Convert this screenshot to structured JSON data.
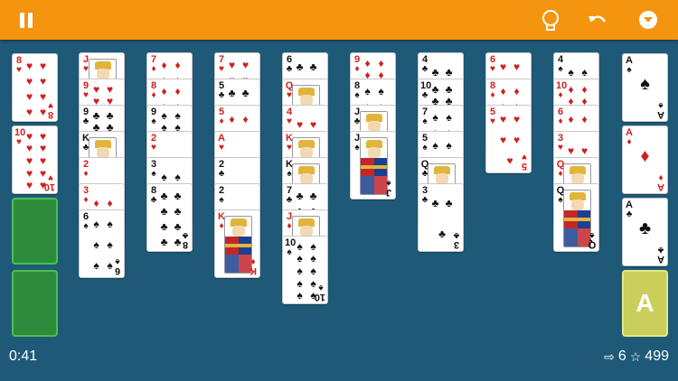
{
  "colors": {
    "topbar": "#f5940f",
    "table": "#1e5a78",
    "free_cell": "#2d8c3c",
    "foundation_slot": "#c9cf5a",
    "red_suit": "#d11f1f"
  },
  "toolbar": {
    "pause_icon": "pause-icon",
    "hint_icon": "lightbulb-icon",
    "undo_icon": "undo-icon",
    "menu_icon": "chevron-down-circle-icon"
  },
  "free_cells": [
    {
      "rank": "8",
      "suit": "♥",
      "color": "red"
    },
    {
      "rank": "10",
      "suit": "♥",
      "color": "red"
    },
    {
      "empty": true
    },
    {
      "empty": true
    }
  ],
  "tableau": [
    [
      {
        "rank": "J",
        "suit": "♥",
        "color": "red"
      },
      {
        "rank": "9",
        "suit": "♥",
        "color": "red"
      },
      {
        "rank": "9",
        "suit": "♣",
        "color": "black"
      },
      {
        "rank": "K",
        "suit": "♣",
        "color": "black"
      },
      {
        "rank": "2",
        "suit": "♦",
        "color": "red"
      },
      {
        "rank": "3",
        "suit": "♦",
        "color": "red"
      },
      {
        "rank": "6",
        "suit": "♠",
        "color": "black"
      }
    ],
    [
      {
        "rank": "7",
        "suit": "♦",
        "color": "red"
      },
      {
        "rank": "8",
        "suit": "♦",
        "color": "red"
      },
      {
        "rank": "9",
        "suit": "♠",
        "color": "black"
      },
      {
        "rank": "2",
        "suit": "♥",
        "color": "red"
      },
      {
        "rank": "3",
        "suit": "♠",
        "color": "black"
      },
      {
        "rank": "8",
        "suit": "♣",
        "color": "black"
      }
    ],
    [
      {
        "rank": "7",
        "suit": "♥",
        "color": "red"
      },
      {
        "rank": "5",
        "suit": "♣",
        "color": "black"
      },
      {
        "rank": "5",
        "suit": "♦",
        "color": "red"
      },
      {
        "rank": "A",
        "suit": "♥",
        "color": "red"
      },
      {
        "rank": "2",
        "suit": "♣",
        "color": "black"
      },
      {
        "rank": "2",
        "suit": "♠",
        "color": "black"
      },
      {
        "rank": "K",
        "suit": "♦",
        "color": "red"
      }
    ],
    [
      {
        "rank": "6",
        "suit": "♣",
        "color": "black"
      },
      {
        "rank": "Q",
        "suit": "♥",
        "color": "red"
      },
      {
        "rank": "4",
        "suit": "♥",
        "color": "red"
      },
      {
        "rank": "K",
        "suit": "♥",
        "color": "red"
      },
      {
        "rank": "K",
        "suit": "♠",
        "color": "black"
      },
      {
        "rank": "7",
        "suit": "♣",
        "color": "black"
      },
      {
        "rank": "J",
        "suit": "♦",
        "color": "red"
      },
      {
        "rank": "10",
        "suit": "♠",
        "color": "black"
      }
    ],
    [
      {
        "rank": "9",
        "suit": "♦",
        "color": "red"
      },
      {
        "rank": "8",
        "suit": "♠",
        "color": "black"
      },
      {
        "rank": "J",
        "suit": "♣",
        "color": "black"
      },
      {
        "rank": "J",
        "suit": "♠",
        "color": "black"
      }
    ],
    [
      {
        "rank": "4",
        "suit": "♣",
        "color": "black"
      },
      {
        "rank": "10",
        "suit": "♣",
        "color": "black"
      },
      {
        "rank": "7",
        "suit": "♠",
        "color": "black"
      },
      {
        "rank": "5",
        "suit": "♠",
        "color": "black"
      },
      {
        "rank": "Q",
        "suit": "♣",
        "color": "black"
      },
      {
        "rank": "3",
        "suit": "♣",
        "color": "black"
      }
    ],
    [
      {
        "rank": "6",
        "suit": "♥",
        "color": "red"
      },
      {
        "rank": "8",
        "suit": "♦",
        "color": "red"
      },
      {
        "rank": "5",
        "suit": "♥",
        "color": "red"
      }
    ],
    [
      {
        "rank": "4",
        "suit": "♠",
        "color": "black"
      },
      {
        "rank": "10",
        "suit": "♦",
        "color": "red"
      },
      {
        "rank": "6",
        "suit": "♦",
        "color": "red"
      },
      {
        "rank": "3",
        "suit": "♥",
        "color": "red"
      },
      {
        "rank": "Q",
        "suit": "♦",
        "color": "red"
      },
      {
        "rank": "Q",
        "suit": "♠",
        "color": "black"
      }
    ]
  ],
  "foundations": [
    {
      "rank": "A",
      "suit": "♠",
      "color": "black"
    },
    {
      "rank": "A",
      "suit": "♦",
      "color": "red"
    },
    {
      "rank": "A",
      "suit": "♣",
      "color": "black"
    },
    {
      "empty": true,
      "label": "A"
    }
  ],
  "status": {
    "timer": "0:41",
    "moves_icon": "moves-arrow-icon",
    "moves": "6",
    "score_icon": "star-icon",
    "score": "499"
  }
}
